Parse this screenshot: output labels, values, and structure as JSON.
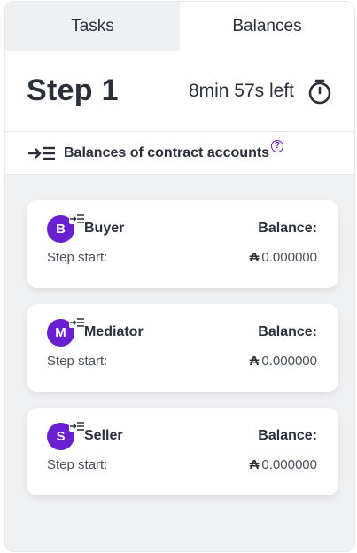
{
  "tabs": [
    {
      "label": "Tasks",
      "active": false
    },
    {
      "label": "Balances",
      "active": true
    }
  ],
  "step": {
    "title": "Step 1",
    "time_left": "8min 57s left",
    "timer_icon": "stopwatch-icon"
  },
  "section": {
    "title": "Balances of contract accounts",
    "icon": "list-in-icon",
    "help": "?"
  },
  "accounts": [
    {
      "initial": "B",
      "name": "Buyer",
      "balance_label": "Balance:",
      "step_start_label": "Step start:",
      "currency": "₳",
      "amount": "0.000000"
    },
    {
      "initial": "M",
      "name": "Mediator",
      "balance_label": "Balance:",
      "step_start_label": "Step start:",
      "currency": "₳",
      "amount": "0.000000"
    },
    {
      "initial": "S",
      "name": "Seller",
      "balance_label": "Balance:",
      "step_start_label": "Step start:",
      "currency": "₳",
      "amount": "0.000000"
    }
  ],
  "colors": {
    "accent": "#6a1fd1",
    "text": "#2a2f3a",
    "background": "#f0f1f3"
  }
}
